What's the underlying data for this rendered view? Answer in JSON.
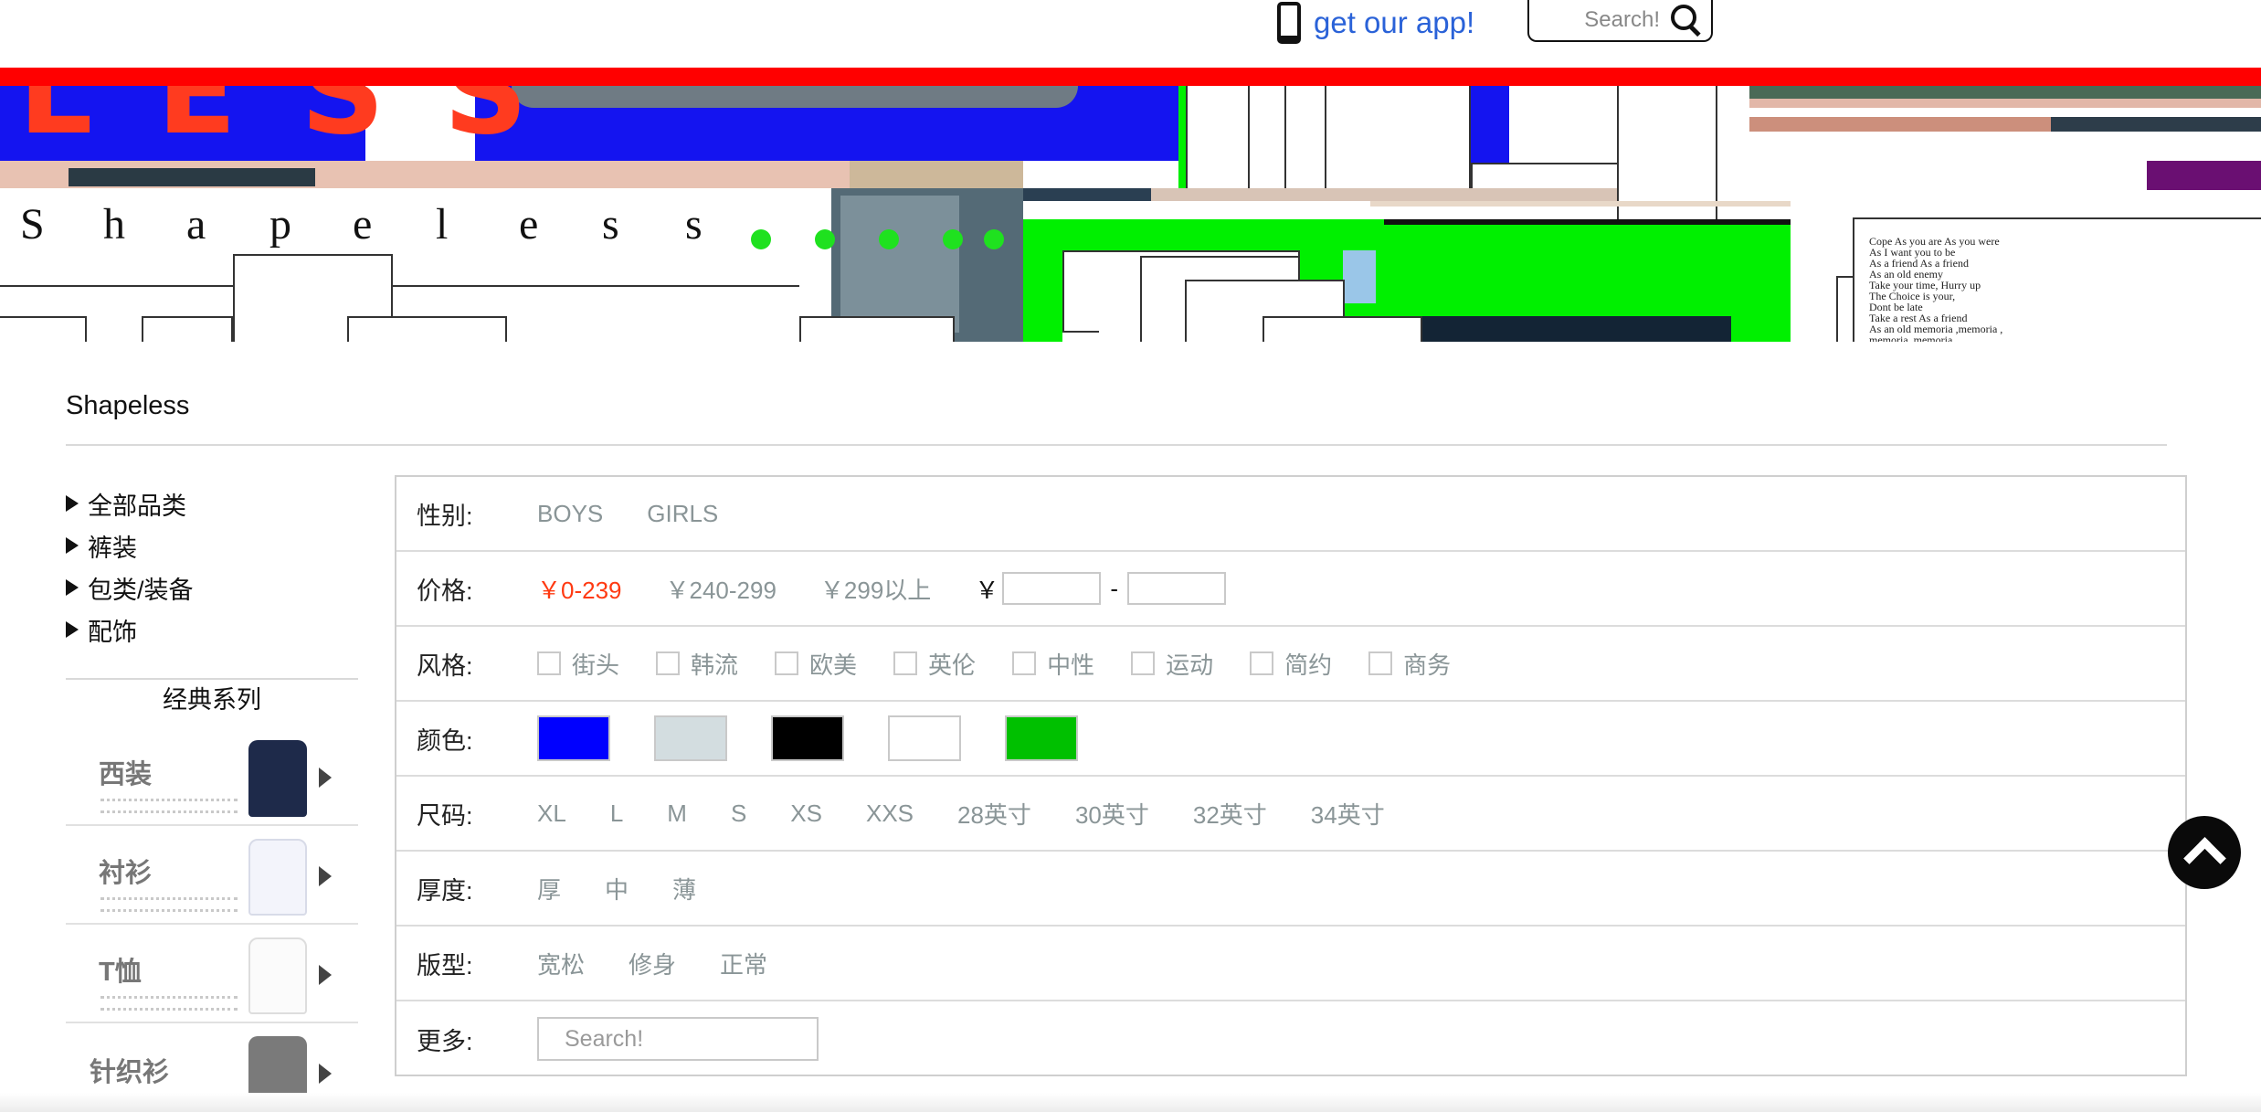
{
  "header": {
    "app_link_label": "get our app!",
    "search_placeholder": "Search!"
  },
  "banner": {
    "brand_word": "LESS",
    "spaced_letters": [
      "S",
      "h",
      "a",
      "p",
      "e",
      "l",
      "e",
      "s",
      "s"
    ],
    "poem": "Cope As you are As you were\nAs I want you to be\nAs a friend As a friend\nAs an old enemy\nTake your time, Hurry up\nThe Choice is your,\nDont be late\nTake a rest As a friend\nAs an old memoria ,memoria ,\nmemoria ,memoria",
    "colors": {
      "stripe": "#ff0000",
      "blue": "#1414f0",
      "green": "#00f000"
    }
  },
  "page": {
    "title": "Shapeless"
  },
  "sidebar": {
    "categories": [
      {
        "label": "全部品类"
      },
      {
        "label": "裤装"
      },
      {
        "label": "包类/装备"
      },
      {
        "label": "配饰"
      }
    ],
    "series_title": "经典系列",
    "series": [
      {
        "label": "西装",
        "thumb_color": "#1e2a4a"
      },
      {
        "label": "衬衫",
        "thumb_color": "#f3f4fb"
      },
      {
        "label": "T恤",
        "thumb_color": "#fbfbfb"
      },
      {
        "label": "针织衫",
        "thumb_color": "#7a7a7a"
      }
    ]
  },
  "filters": {
    "gender": {
      "label": "性别:",
      "options": [
        "BOYS",
        "GIRLS"
      ]
    },
    "price": {
      "label": "价格:",
      "options": [
        "￥0-239",
        "￥240-299",
        "￥299以上"
      ],
      "active_index": 0,
      "currency": "￥",
      "range_separator": "-"
    },
    "style": {
      "label": "风格:",
      "options": [
        "街头",
        "韩流",
        "欧美",
        "英伦",
        "中性",
        "运动",
        "简约",
        "商务"
      ]
    },
    "color": {
      "label": "颜色:",
      "swatches": [
        "#0000ff",
        "#d3dde0",
        "#000000",
        "#ffffff",
        "#00c000"
      ]
    },
    "size": {
      "label": "尺码:",
      "options": [
        "XL",
        "L",
        "M",
        "S",
        "XS",
        "XXS",
        "28英寸",
        "30英寸",
        "32英寸",
        "34英寸"
      ]
    },
    "thickness": {
      "label": "厚度:",
      "options": [
        "厚",
        "中",
        "薄"
      ]
    },
    "fit": {
      "label": "版型:",
      "options": [
        "宽松",
        "修身",
        "正常"
      ]
    },
    "more": {
      "label": "更多:",
      "placeholder": "Search!"
    }
  },
  "accent_color": "#ff3a12"
}
